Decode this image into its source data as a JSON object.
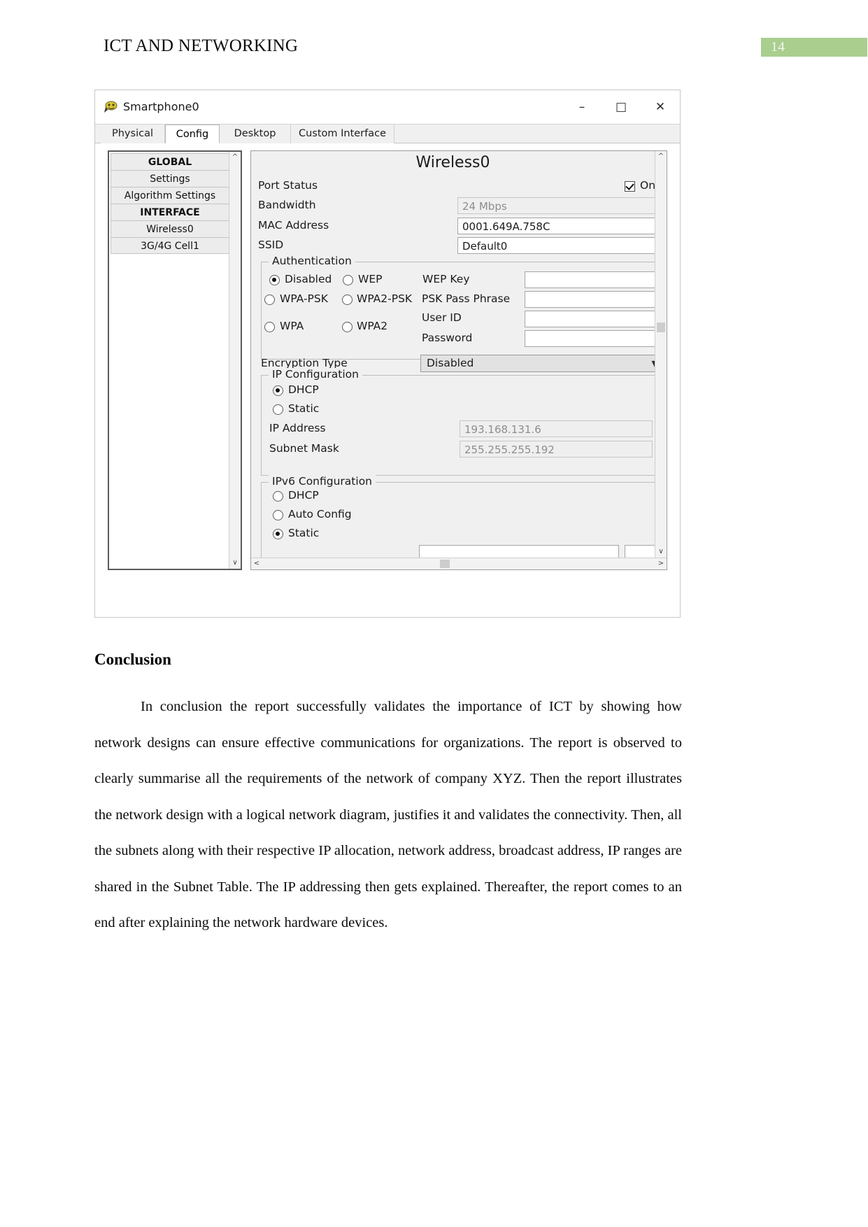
{
  "page": {
    "header_title": "ICT AND NETWORKING",
    "page_number": "14",
    "badge_color": "#a9ce8e"
  },
  "window": {
    "title": "Smartphone0",
    "icon": "smartphone-device-icon",
    "controls": {
      "minimize": "–",
      "maximize": "□",
      "close": "✕"
    },
    "tabs": [
      {
        "label": "Physical",
        "active": false
      },
      {
        "label": "Config",
        "active": true
      },
      {
        "label": "Desktop",
        "active": false
      },
      {
        "label": "Custom Interface",
        "active": false
      }
    ],
    "tree": [
      {
        "label": "GLOBAL",
        "bold": true
      },
      {
        "label": "Settings",
        "bold": false
      },
      {
        "label": "Algorithm Settings",
        "bold": false
      },
      {
        "label": "INTERFACE",
        "bold": true
      },
      {
        "label": "Wireless0",
        "bold": false
      },
      {
        "label": "3G/4G Cell1",
        "bold": false
      }
    ],
    "config": {
      "title": "Wireless0",
      "port_status": {
        "label": "Port Status",
        "on_label": "On",
        "checked": true
      },
      "bandwidth": {
        "label": "Bandwidth",
        "value": "24 Mbps"
      },
      "mac_address": {
        "label": "MAC Address",
        "value": "0001.649A.758C"
      },
      "ssid": {
        "label": "SSID",
        "value": "Default0"
      },
      "authentication": {
        "title": "Authentication",
        "options": [
          {
            "label": "Disabled",
            "selected": true
          },
          {
            "label": "WEP",
            "selected": false
          },
          {
            "label": "WPA-PSK",
            "selected": false
          },
          {
            "label": "WPA2-PSK",
            "selected": false
          },
          {
            "label": "WPA",
            "selected": false
          },
          {
            "label": "WPA2",
            "selected": false
          }
        ],
        "fields": [
          {
            "label": "WEP Key",
            "value": ""
          },
          {
            "label": "PSK Pass Phrase",
            "value": ""
          },
          {
            "label": "User ID",
            "value": ""
          },
          {
            "label": "Password",
            "value": ""
          }
        ]
      },
      "encryption_type": {
        "label": "Encryption Type",
        "value": "Disabled"
      },
      "ip_configuration": {
        "title": "IP Configuration",
        "options": [
          {
            "label": "DHCP",
            "selected": true
          },
          {
            "label": "Static",
            "selected": false
          }
        ],
        "ip_address": {
          "label": "IP Address",
          "value": "193.168.131.6"
        },
        "subnet_mask": {
          "label": "Subnet Mask",
          "value": "255.255.255.192"
        }
      },
      "ipv6_configuration": {
        "title": "IPv6 Configuration",
        "options": [
          {
            "label": "DHCP",
            "selected": false
          },
          {
            "label": "Auto Config",
            "selected": false
          },
          {
            "label": "Static",
            "selected": true
          }
        ]
      }
    }
  },
  "conclusion": {
    "heading": "Conclusion",
    "paragraph": "In conclusion the report successfully validates the importance of ICT by showing how network designs can ensure effective communications for organizations. The report is observed to clearly summarise all the requirements of the network of company XYZ. Then the report illustrates the network design with a logical network diagram, justifies it and validates the connectivity. Then, all the subnets along with their respective IP allocation, network address, broadcast address, IP ranges are shared in the Subnet Table. The IP addressing then gets explained. Thereafter, the report comes to an end after explaining the network hardware devices."
  }
}
